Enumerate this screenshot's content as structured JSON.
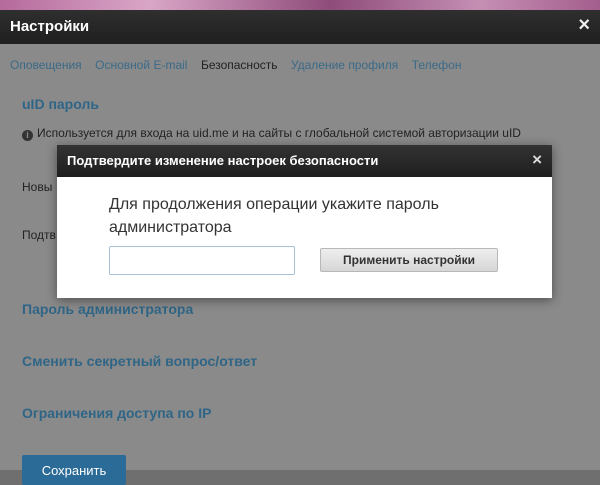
{
  "settings": {
    "title": "Настройки",
    "close_glyph": "×",
    "tabs": [
      "Оповещения",
      "Основной E-mail",
      "Безопасность",
      "Удаление профиля",
      "Телефон"
    ],
    "active_tab": "Безопасность",
    "uid_section_title": "uID пароль",
    "uid_note": "Используется для входа на uid.me и на сайты с глобальной системой авторизации uID",
    "new_password_label": "Новы",
    "confirm_password_label": "Подтв",
    "admin_password_title": "Пароль администратора",
    "secret_question_title": "Сменить секретный вопрос/ответ",
    "ip_restriction_title": "Ограничения доступа по IP",
    "save_label": "Сохранить"
  },
  "modal": {
    "title": "Подтвердите изменение настроек безопасности",
    "close_glyph": "×",
    "message": "Для продолжения операции укажите пароль администратора",
    "password_value": "",
    "password_placeholder": "",
    "apply_label": "Применить настройки"
  }
}
